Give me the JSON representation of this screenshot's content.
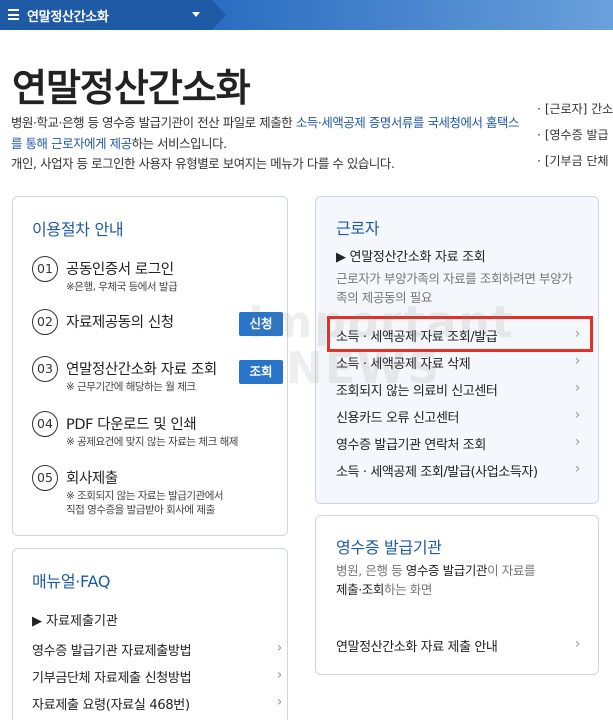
{
  "topbar": {
    "title": "연말정산간소화"
  },
  "header": {
    "title": "연말정산간소화",
    "desc_1": "병원·학교·은행 등 영수증 발급기관이 전산 파일로 제출한 ",
    "desc_link": "소득·세액공제 증명서류를 국세청에서 홈택스를 통해 근로자에게 제공",
    "desc_2": "하는 서비스입니다.",
    "desc_3": "개인, 사업자 등 로그인한 사용자 유형별로 보여지는 메뉴가 다를 수 있습니다."
  },
  "side_notes": [
    "[근로자] 간소",
    "[영수증 발급",
    "[기부금 단체"
  ],
  "steps": {
    "title": "이용절차 안내",
    "items": [
      {
        "num": "01",
        "label": "공동인증서 로그인",
        "note": "※은행, 우체국 등에서 발급",
        "button": ""
      },
      {
        "num": "02",
        "label": "자료제공동의 신청",
        "note": "",
        "button": "신청"
      },
      {
        "num": "03",
        "label": "연말정산간소화 자료 조회",
        "note": "※ 근무기간에 해당하는 월 체크",
        "button": "조회"
      },
      {
        "num": "04",
        "label": "PDF 다운로드 및 인쇄",
        "note": "※ 공제요건에 맞지 않는 자료는 체크 해제",
        "button": ""
      },
      {
        "num": "05",
        "label": "회사제출",
        "note": "※ 조회되지 않는 자료는 발급기관에서",
        "note2": "직접 영수증을 발급받아 회사에 제출",
        "button": ""
      }
    ]
  },
  "faq": {
    "title": "매뉴얼·FAQ",
    "sub": "▶ 자료제출기관",
    "items": [
      "영수증 발급기관 자료제출방법",
      "기부금단체 자료제출 신청방법",
      "자료제출 요령(자료실 468번)"
    ]
  },
  "worker": {
    "title": "근로자",
    "sub": "▶ 연말정산간소화 자료 조회",
    "desc": "근로자가 부양가족의 자료를 조회하려면 부양가족의 제공동의 필요",
    "items": [
      "소득 · 세액공제 자료 조회/발급",
      "소득 · 세액공제 자료 삭제",
      "조회되지 않는 의료비 신고센터",
      "신용카드 오류 신고센터",
      "영수증 발급기관 연락처 조회",
      "소득 · 세액공제 조회/발급(사업소득자)"
    ]
  },
  "issuer": {
    "title": "영수증 발급기관",
    "desc_1": "병원, 은행 등 ",
    "desc_dk": "영수증 발급기관",
    "desc_2": "이 자료를",
    "desc_3": "제출·조회",
    "desc_4": "하는 화면",
    "item": "연말정산간소화 자료 제출 안내"
  },
  "watermark": {
    "line1": "Important",
    "line2": "NEWS"
  },
  "colors": {
    "brand": "#1f5aa6",
    "button": "#2875c9",
    "highlight": "#e53026"
  }
}
